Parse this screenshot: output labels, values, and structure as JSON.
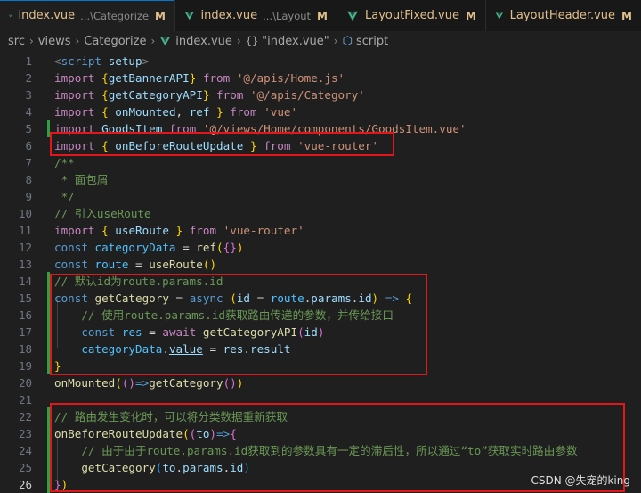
{
  "tabs": [
    {
      "name": "index.vue",
      "desc": "...\\Categorize",
      "mod": "M",
      "active": true
    },
    {
      "name": "index.vue",
      "desc": "...\\Layout",
      "mod": "M",
      "active": false
    },
    {
      "name": "LayoutFixed.vue",
      "desc": "",
      "mod": "M",
      "active": false
    },
    {
      "name": "LayoutHeader.vue",
      "desc": "",
      "mod": "M",
      "active": false
    }
  ],
  "breadcrumb": {
    "src": "src",
    "views": "views",
    "categorize": "Categorize",
    "file": "index.vue",
    "symbol": "\"index.vue\"",
    "script": "script"
  },
  "line_numbers": [
    "1",
    "2",
    "3",
    "4",
    "5",
    "6",
    "7",
    "8",
    "9",
    "10",
    "11",
    "12",
    "13",
    "14",
    "15",
    "16",
    "17",
    "18",
    "19",
    "20",
    "21",
    "22",
    "23",
    "24",
    "25",
    "26"
  ],
  "current_line": "26",
  "watermark": "CSDN @失宠的king",
  "colors": {
    "accent": "#0078d4",
    "highlight_box": "#e3161c",
    "git_added": "#2ea043"
  }
}
